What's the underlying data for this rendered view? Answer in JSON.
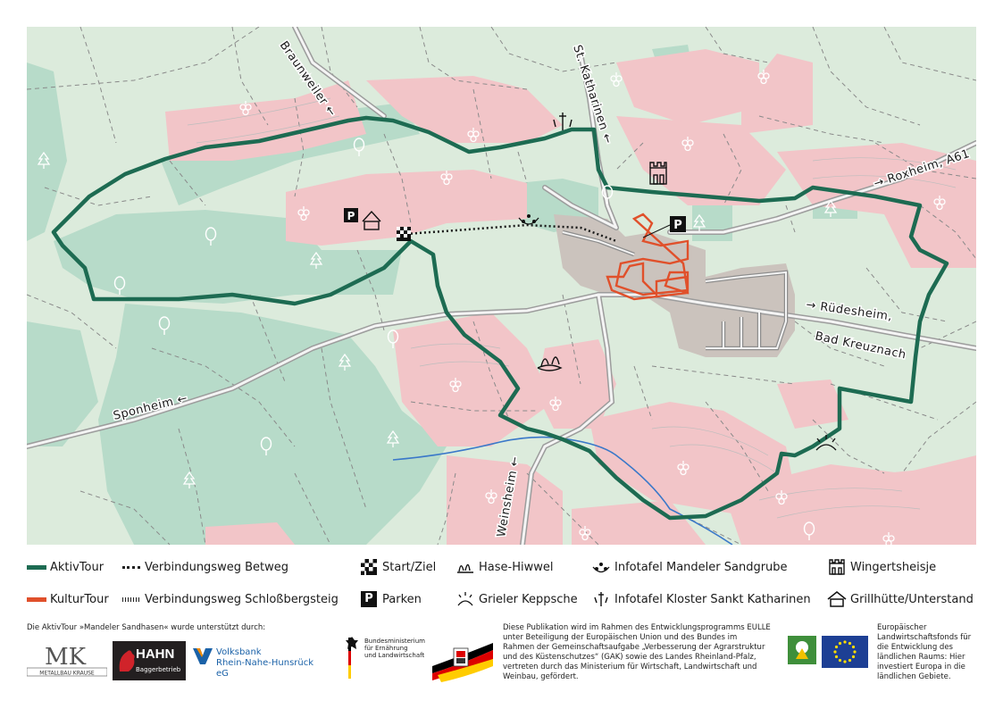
{
  "map": {
    "labels": {
      "braunweiler": "Braunweiler ←",
      "st_katharinen": "St. Katharinen ←",
      "roxheim": "→ Roxheim, A61",
      "ruedesheim_1": "→ Rüdesheim,",
      "ruedesheim_2": "Bad Kreuznach",
      "sponheim": "Sponheim ←",
      "weinsheim": "Weinsheim ←"
    },
    "colors": {
      "vineyard": "#f2c5c8",
      "field": "#dcebdc",
      "forest": "#b7dbc9",
      "settlement": "#cbc3bd",
      "road": "#9c9c9c",
      "aktiv_tour": "#1d6b52",
      "kultur_tour": "#e0502b",
      "river": "#3a78c9"
    }
  },
  "legend": {
    "aktiv_tour": "AktivTour",
    "kultur_tour": "KulturTour",
    "verbindungsweg_betweg": "Verbindungsweg Betweg",
    "verbindungsweg_schlossbergsteig": "Verbindungsweg Schloßbergsteig",
    "start_ziel": "Start/Ziel",
    "parken": "Parken",
    "hase_hiwwel": "Hase-Hiwwel",
    "grieler_keppsche": "Grieler Keppsche",
    "infotafel_sandgrube": "Infotafel Mandeler Sandgrube",
    "infotafel_kloster": "Infotafel Kloster Sankt Katharinen",
    "wingertsheisje": "Wingertsheisje",
    "grillhuette": "Grillhütte/Unterstand",
    "parking_letter": "P"
  },
  "footer": {
    "support_title": "Die AktivTour »Mandeler Sandhasen« wurde unterstützt durch:",
    "mk": "MK",
    "mk_sub": "METALLBAU KRAUSE",
    "hahn": "HAHN",
    "hahn_sub": "Baggerbetrieb",
    "volksbank_1": "Volksbank",
    "volksbank_2": "Rhein-Nahe-Hunsrück eG",
    "bmel_1": "Bundesministerium",
    "bmel_2": "für Ernährung",
    "bmel_3": "und Landwirtschaft",
    "pub_text": "Diese Publikation wird im Rahmen des Entwicklungsprogramms EULLE unter Beteiligung der Europäischen Union und des Bundes im Rahmen der Gemeinschaftsaufgabe „Verbesserung der Agrarstruktur und des Küstenschutzes“ (GAK) sowie des Landes Rheinland-Pfalz, vertreten durch das Ministerium für Wirtschaft, Landwirtschaft und Weinbau, gefördert.",
    "eler_text": "Europäischer Landwirtschaftsfonds für die Entwicklung des ländlichen Raums: Hier investiert Europa in die ländlichen Gebiete."
  }
}
